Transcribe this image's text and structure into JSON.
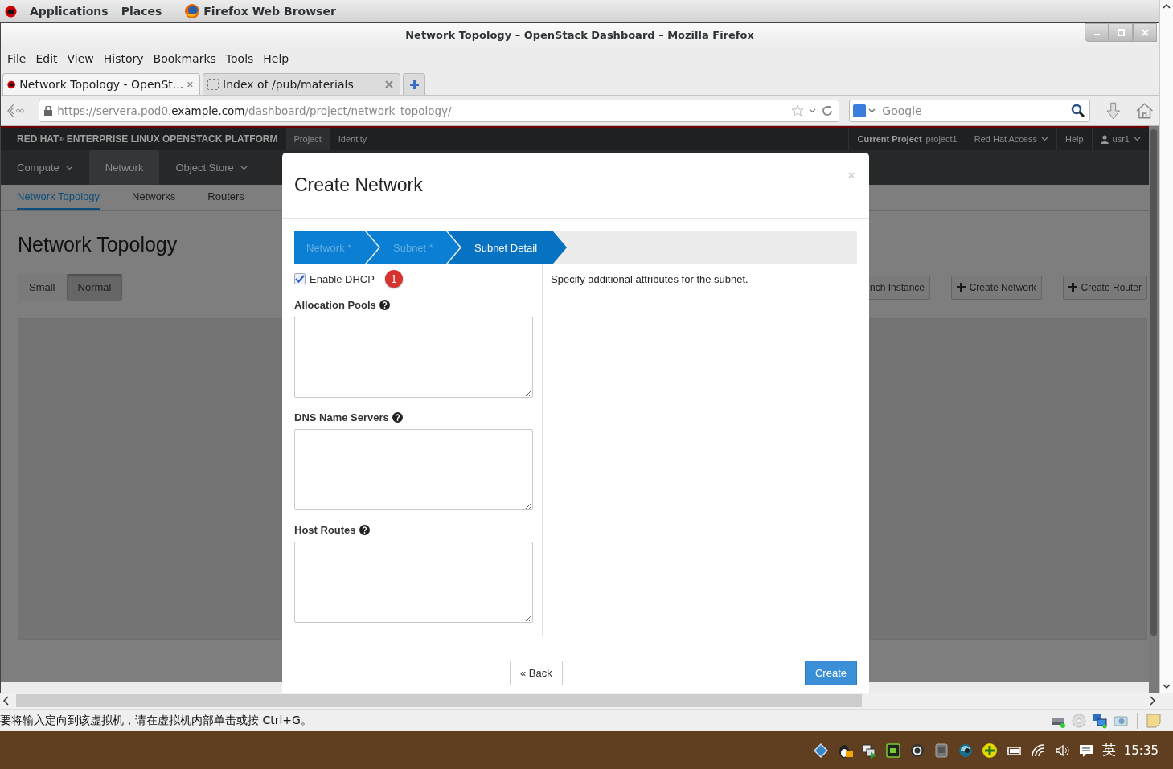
{
  "desktop_bar": {
    "menus": [
      "Applications",
      "Places"
    ],
    "app": "Firefox Web Browser"
  },
  "browser": {
    "title": "Network Topology – OpenStack Dashboard – Mozilla Firefox",
    "menu": [
      "File",
      "Edit",
      "View",
      "History",
      "Bookmarks",
      "Tools",
      "Help"
    ],
    "tabs": [
      {
        "label": "Network Topology - OpenSt...",
        "selected": true
      },
      {
        "label": "Index of /pub/materials",
        "selected": false
      }
    ],
    "url": "https://servera.pod0.**example.com**/dashboard/project/network_topology/",
    "search": {
      "placeholder": "Google"
    }
  },
  "dashboard": {
    "brand": "RED HAT$^{®}$ ENTERPRISE LINUX OPENSTACK PLATFORM",
    "top_tabs": [
      {
        "label": "Project",
        "selected": true
      },
      {
        "label": "Identity",
        "selected": false
      }
    ],
    "project_selector": "**Current Project** project1",
    "top_right": [
      {
        "label": "Red Hat Access",
        "kind": "dropdown"
      },
      {
        "label": "Help",
        "kind": "link"
      },
      {
        "label": "usr1",
        "kind": "user"
      }
    ],
    "nav": [
      {
        "label": "Compute",
        "dropdown": true,
        "selected": false
      },
      {
        "label": "Network",
        "dropdown": false,
        "selected": true
      },
      {
        "label": "Object Store",
        "dropdown": true,
        "selected": false
      }
    ],
    "subnav": [
      {
        "label": "Network Topology",
        "selected": true
      },
      {
        "label": "Networks",
        "selected": false
      },
      {
        "label": "Routers",
        "selected": false
      }
    ],
    "heading": "Network Topology",
    "size_toggle": [
      {
        "label": "Small",
        "selected": false
      },
      {
        "label": "Normal",
        "selected": true
      }
    ],
    "actions": [
      {
        "label": "nch Instance",
        "icon": false
      },
      {
        "label": "Create Network",
        "icon": true
      },
      {
        "label": "Create Router",
        "icon": true
      }
    ]
  },
  "modal": {
    "title": "Create Network",
    "steps": [
      {
        "label": "Network *",
        "selected": false
      },
      {
        "label": "Subnet *",
        "selected": false
      },
      {
        "label": "Subnet Detail",
        "selected": true
      }
    ],
    "dhcp": {
      "label": "Enable DHCP",
      "checked": true
    },
    "badge": "1",
    "fields": [
      {
        "label": "Allocation Pools"
      },
      {
        "label": "DNS Name Servers"
      },
      {
        "label": "Host Routes"
      }
    ],
    "help": "Specify additional attributes for the subnet.",
    "back": "« Back",
    "create": "Create"
  },
  "status_bar": {
    "message": "要将输入定向到该虚拟机，请在虚拟机内部单击或按 Ctrl+G。"
  },
  "taskbar": {
    "ime": "英",
    "clock": "15:35"
  }
}
